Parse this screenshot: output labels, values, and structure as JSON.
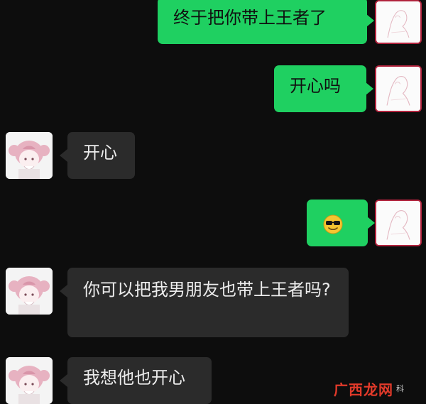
{
  "chat": {
    "messages": [
      {
        "side": "out",
        "text": "终于把你带上王者了"
      },
      {
        "side": "out",
        "text": "开心吗"
      },
      {
        "side": "in",
        "text": "开心"
      },
      {
        "side": "out",
        "emoji": "sunglasses-smile"
      },
      {
        "side": "in",
        "text": "你可以把我男朋友也带上王者吗?"
      },
      {
        "side": "in",
        "text": "我想他也开心"
      }
    ]
  },
  "colors": {
    "background": "#0d0d0d",
    "outgoing_bubble": "#1fd061",
    "incoming_bubble": "#2b2b2b",
    "avatar_border_right": "#b1233d"
  },
  "watermark": {
    "brand": "广西龙网",
    "suffix": "科"
  }
}
